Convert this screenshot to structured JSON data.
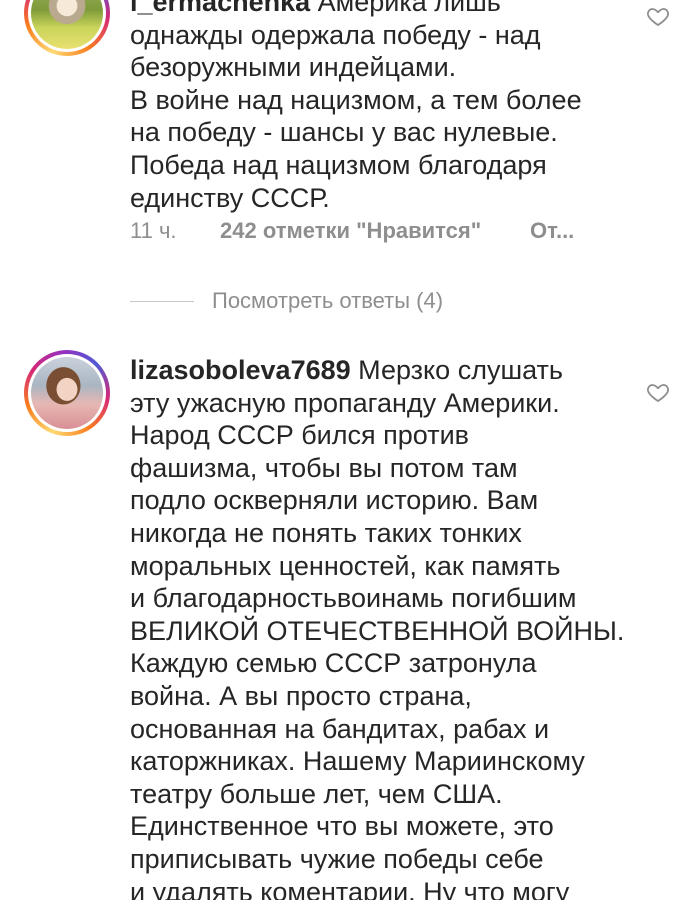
{
  "comments": [
    {
      "username": "l_ermachenka",
      "text_lines": [
        "Америка лишь",
        "однажды одержала победу - над",
        "безоружными индейцами.",
        "В войне над нацизмом, а тем более",
        "на победу - шансы у вас нулевые.",
        "Победа над нацизмом благодаря",
        "единству СССР."
      ],
      "time": "11 ч.",
      "likes": "242 отметки \"Нравится\"",
      "reply": "От..."
    },
    {
      "username": "lizasoboleva7689",
      "text_lines": [
        "Мерзко слушать",
        "эту ужасную пропаганду Америки.",
        "Народ СССР бился против",
        "фашизма, чтобы вы потом там",
        "подло оскверняли историю. Вам",
        "никогда не понять таких тонких",
        "моральных ценностей, как память",
        "и благодарностьвоинамь погибшим",
        "ВЕЛИКОЙ ОТЕЧЕСТВЕННОЙ ВОЙНЫ.",
        "Каждую семью СССР затронула",
        "война. А вы просто страна,",
        "основанная на бандитах, рабах и",
        "каторжниках. Нашему Мариинскому",
        "театру больше лет, чем США.",
        "Единственное что вы можете, это",
        "приписывать чужие победы себе",
        "и удалять коментарии. Ну что могу"
      ]
    }
  ],
  "view_replies": "Посмотреть ответы (4)",
  "icons": {
    "like": "heart-outline-icon"
  }
}
